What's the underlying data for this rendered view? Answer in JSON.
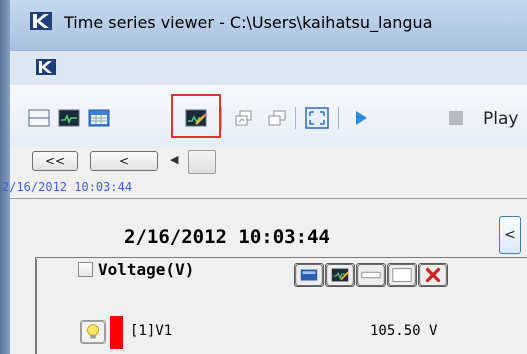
{
  "window": {
    "title": "Time series viewer - C:\\Users\\kaihatsu_langua"
  },
  "toolbar": {
    "play_label": "Play",
    "icons": [
      "single-pane-icon",
      "chart-icon",
      "table-icon",
      "edit-chart-icon",
      "restore-icon",
      "tile-icon",
      "fullscreen-icon",
      "play-icon",
      "stop-icon"
    ]
  },
  "nav": {
    "first_label": "<<",
    "prev_label": "<",
    "timestamp_small": "2/16/2012  10:03:44"
  },
  "main": {
    "timestamp": "2/16/2012 10:03:44",
    "prev_button": "<"
  },
  "series": {
    "title": "Voltage(V)",
    "variables": [
      {
        "name": "[1]V1",
        "value": "105.50 V",
        "color": "#ff0000"
      }
    ]
  },
  "colors": {
    "highlight": "#e23333",
    "timestamp_blue": "#3e5ef0"
  }
}
